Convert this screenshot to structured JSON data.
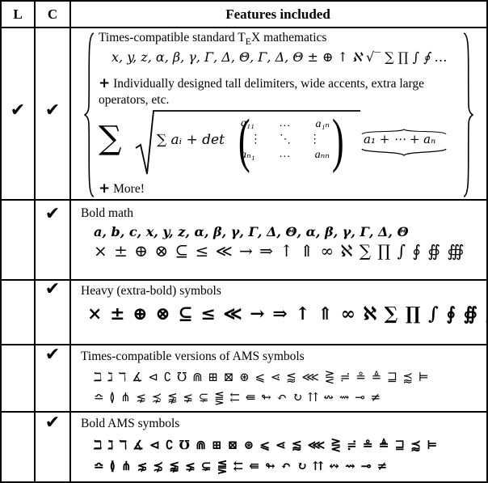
{
  "header": {
    "col_l": "L",
    "col_c": "C",
    "col_features": "Features included"
  },
  "check_glyph": "✔",
  "rows": [
    {
      "l": true,
      "c": true,
      "title": "Times-compatible standard TEX mathematics",
      "title_pre": "Times-compatible standard T",
      "title_e": "E",
      "title_post": "X mathematics",
      "symbols_line": "x, y, z, α, β, γ, Γ, Δ, Θ, Γ, Δ, Θ ± ⊕ ↑ ℵ √‾ ∑ ∏ ∫ ∮ …",
      "plus_text": "+ Individually designed tall delimiters, wide accents, extra large operators, etc.",
      "plus_text_line1": "Individually designed tall delimiters, wide accents, extra large",
      "plus_text_line2": "operators, etc.",
      "formula": {
        "sum": "∑",
        "inner": "∑ aᵢ + det",
        "matrix": [
          [
            "a₁₁",
            "…",
            "a₁ₙ"
          ],
          [
            "⋮",
            "⋱",
            "⋮"
          ],
          [
            "aₙ₁",
            "…",
            "aₙₙ"
          ]
        ],
        "overbrace": "a₁ + ⋯ + aₙ"
      },
      "more": "More!"
    },
    {
      "l": false,
      "c": true,
      "title": "Bold math",
      "line1": "a, b, c, x, y, z, α, β, γ, Γ, Δ, Θ, α, β, γ, Γ, Δ, Θ",
      "line2": "× ± ⊕ ⊗ ⊆ ≤ ≪ → ⇒ ↑ ⇑ ∞ ℵ ∑ ∏ ∫ ∮ ∯ ∰"
    },
    {
      "l": false,
      "c": true,
      "title": "Heavy (extra-bold) symbols",
      "line1": "× ± ⊕ ⊗ ⊆ ≤ ≪ → ⇒ ↑ ⇑ ∞ ℵ ∑ ∏ ∫ ∮ ∯ ∰"
    },
    {
      "l": false,
      "c": true,
      "title": "Times-compatible versions of AMS symbols",
      "line1": "ℶ ℷ ℸ ∡ ⊲ ∁ ℧ ⋒ ⊞ ⊠ ⊛ ⩽ ⋖ ⪅ ⋘ ⋛ ≓ ≗ ≜ ⊒ ⪷ ⊨",
      "line2": "≏ ≬ ⋔ ⋦ ⋨ ⪉ ⪇ ⊊ ⪋ ⇇ ⇚ ↬ ↶ ↻ ⇈ ↭ ⇝ ⊸ ≠"
    },
    {
      "l": false,
      "c": true,
      "title": "Bold AMS symbols",
      "line1": "ℶ ℷ ℸ ∡ ⊲ ∁ ℧ ⋒ ⊞ ⊠ ⊛ ⩽ ⋖ ⪅ ⋘ ⋛ ≓ ≗ ≜ ⊒ ⪷ ⊨",
      "line2": "≏ ≬ ⋔ ⋦ ⋨ ⪉ ⪇ ⊊ ⪋ ⇇ ⇚ ↬ ↶ ↻ ⇈ ↭ ⇝ ⊸ ≠"
    }
  ]
}
